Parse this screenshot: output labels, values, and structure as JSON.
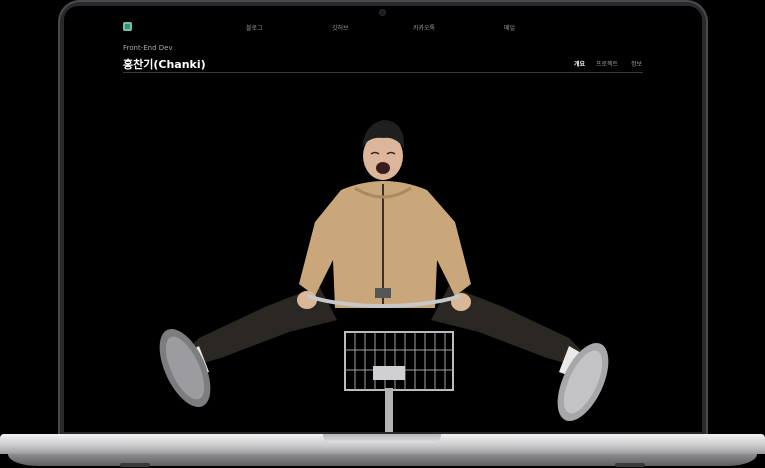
{
  "site": {
    "nav": [
      "블로그",
      "깃허브",
      "카카오톡",
      "메일"
    ],
    "subtitle": "Front-End Dev",
    "title": "홍찬기(Chanki)",
    "tabs": [
      {
        "label": "개요",
        "active": true
      },
      {
        "label": "프로젝트",
        "active": false
      },
      {
        "label": "정보",
        "active": false
      }
    ]
  },
  "colors": {
    "background": "#000000",
    "text_primary": "#ffffff",
    "text_muted": "#9a9a9a",
    "logo": "#3d8b7a"
  },
  "icons": {
    "logo": "site-logo-icon"
  }
}
